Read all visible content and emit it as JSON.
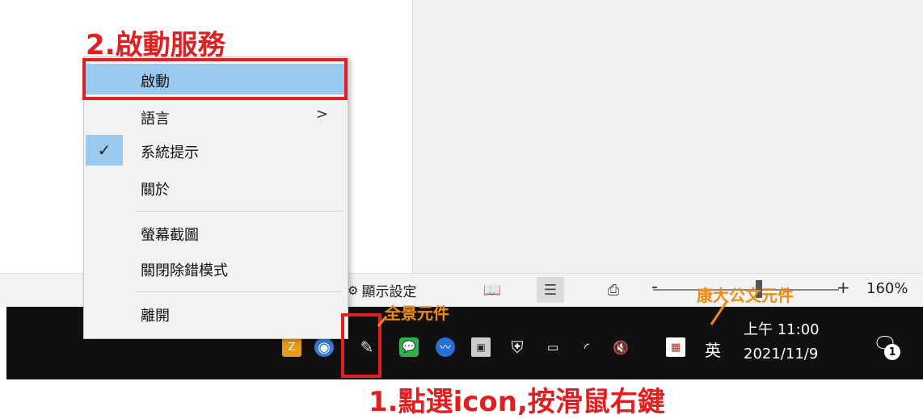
{
  "statusbar": {
    "display_settings": "顯示設定",
    "zoom_level": "160%",
    "zoom_minus": "-",
    "zoom_plus": "+"
  },
  "menu": {
    "items": [
      {
        "label": "啟動",
        "hovered": true
      },
      {
        "label": "語言",
        "submenu_arrow": ">"
      },
      {
        "label": "系統提示",
        "checked": true
      },
      {
        "label": "關於"
      },
      {
        "label": "螢幕截圖"
      },
      {
        "label": "關閉除錯模式"
      },
      {
        "label": "離開"
      }
    ],
    "check_glyph": "✓"
  },
  "taskbar": {
    "ime": "英",
    "clock_time": "上午 11:00",
    "clock_date": "2021/11/9",
    "notification_badge": "1",
    "tray_icons": [
      "app-icon",
      "globe-icon",
      "kangda-icon",
      "line-icon",
      "network-monitor-icon",
      "screenshot-tool-icon",
      "security-shield-icon",
      "battery-icon",
      "wifi-icon",
      "volume-muted-icon",
      "kangda-doc-icon"
    ]
  },
  "annotations": {
    "step2": "2.啟動服務",
    "step1": "1.點選icon,按滑鼠右鍵",
    "label_quanjing": "全景元件",
    "label_kangda": "康大公文元件"
  },
  "colors": {
    "annotation_red": "#e02020",
    "annotation_orange": "#f08a10",
    "menu_highlight": "#99c9ef",
    "taskbar_bg": "#101010"
  }
}
